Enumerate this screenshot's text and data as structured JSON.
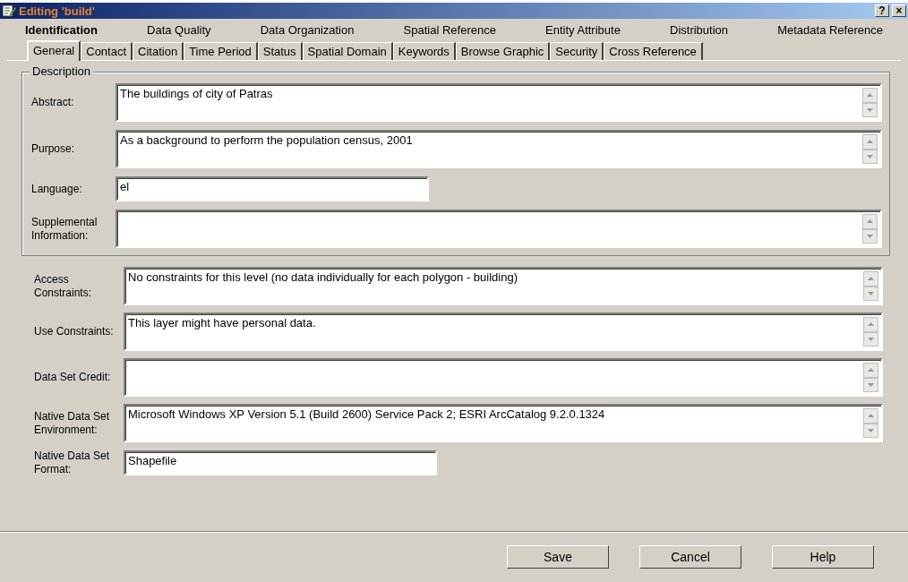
{
  "window": {
    "title": "Editing 'build'",
    "help": "?",
    "close": "×"
  },
  "sections": [
    {
      "label": "Identification",
      "selected": true
    },
    {
      "label": "Data Quality",
      "selected": false
    },
    {
      "label": "Data Organization",
      "selected": false
    },
    {
      "label": "Spatial Reference",
      "selected": false
    },
    {
      "label": "Entity Attribute",
      "selected": false
    },
    {
      "label": "Distribution",
      "selected": false
    },
    {
      "label": "Metadata Reference",
      "selected": false
    }
  ],
  "tabs": [
    {
      "label": "General",
      "selected": true
    },
    {
      "label": "Contact",
      "selected": false
    },
    {
      "label": "Citation",
      "selected": false
    },
    {
      "label": "Time Period",
      "selected": false
    },
    {
      "label": "Status",
      "selected": false
    },
    {
      "label": "Spatial Domain",
      "selected": false
    },
    {
      "label": "Keywords",
      "selected": false
    },
    {
      "label": "Browse Graphic",
      "selected": false
    },
    {
      "label": "Security",
      "selected": false
    },
    {
      "label": "Cross Reference",
      "selected": false
    }
  ],
  "description": {
    "title": "Description",
    "fields": [
      {
        "label": "Abstract:",
        "kind": "multiline",
        "value": "The buildings of city of Patras"
      },
      {
        "label": "Purpose:",
        "kind": "multiline",
        "value": "As a background to perform the population census, 2001"
      },
      {
        "label": "Language:",
        "kind": "single",
        "value": "el"
      },
      {
        "label": "Supplemental Information:",
        "kind": "multiline"
      }
    ]
  },
  "fields": [
    {
      "label": "Access Constraints:",
      "kind": "multiline",
      "value": "No constraints for this level (no data individually for each polygon - building)"
    },
    {
      "label": "Use Constraints:",
      "kind": "multiline",
      "value": "This layer might have personal data."
    },
    {
      "label": "Data Set Credit:",
      "kind": "multiline"
    },
    {
      "label": "Native Data Set Environment:",
      "kind": "multiline",
      "value": "Microsoft Windows XP Version 5.1 (Build 2600) Service Pack 2; ESRI ArcCatalog 9.2.0.1324"
    },
    {
      "label": "Native Data Set Format:",
      "kind": "single",
      "value": "Shapefile"
    }
  ],
  "buttons": [
    "Save",
    "Cancel",
    "Help"
  ]
}
